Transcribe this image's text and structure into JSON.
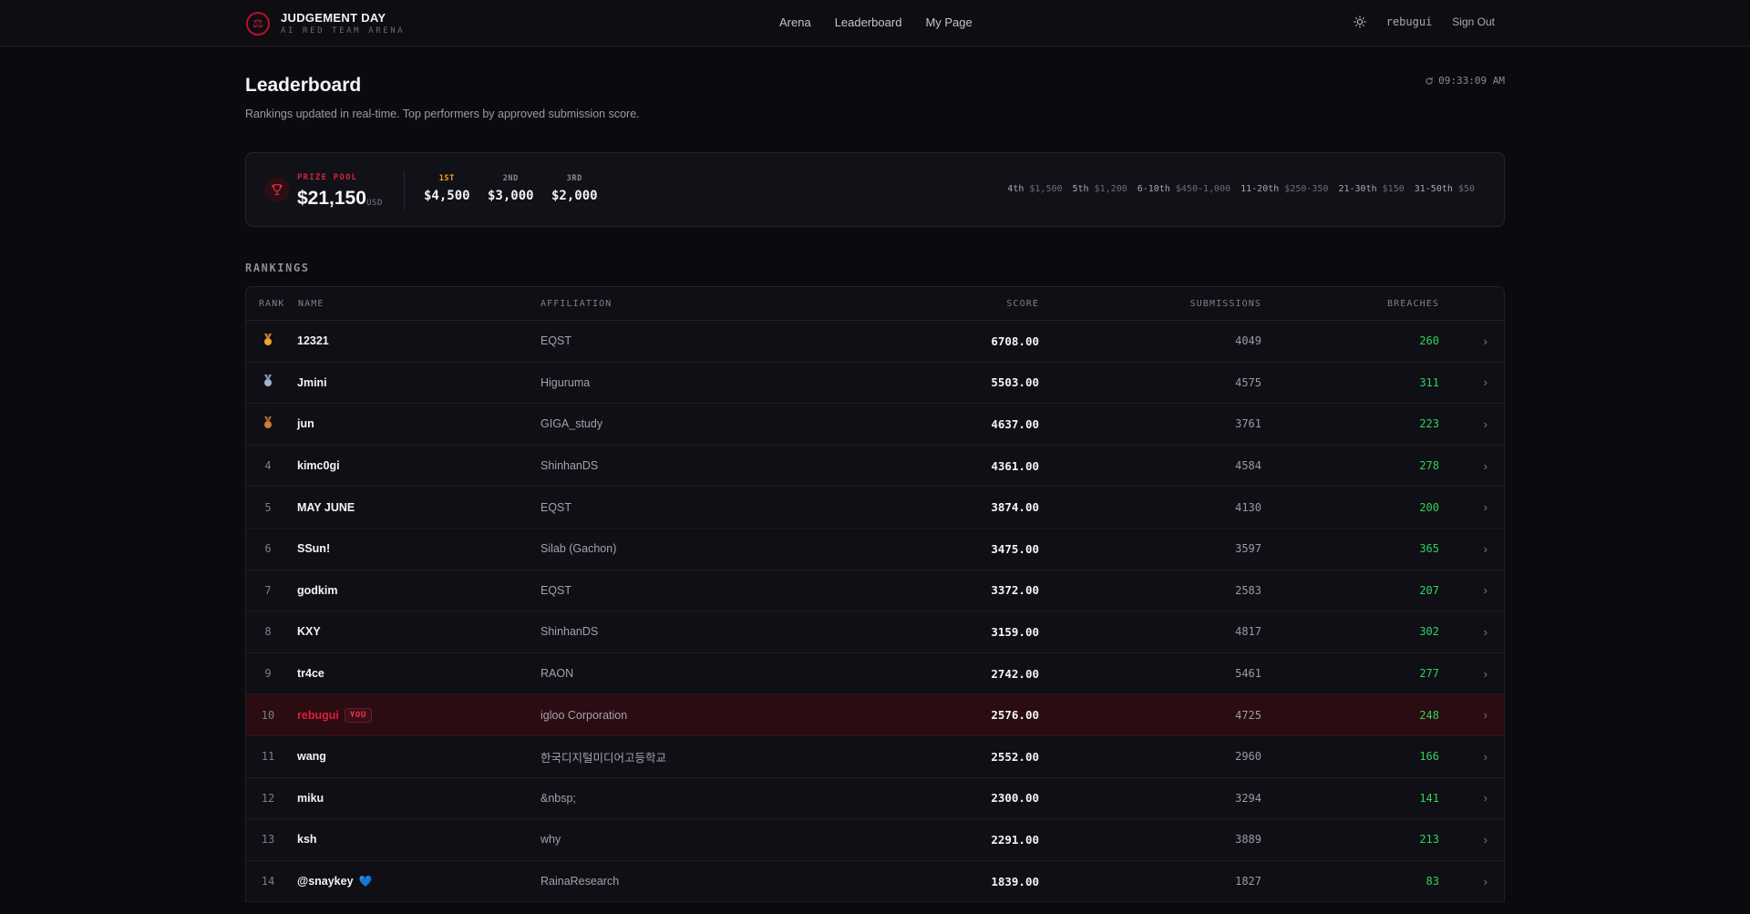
{
  "brand": {
    "title": "JUDGEMENT DAY",
    "subtitle": "AI RED TEAM ARENA",
    "logo_icon": "scales-icon",
    "accent": "#d11a35"
  },
  "nav": {
    "links": [
      "Arena",
      "Leaderboard",
      "My Page"
    ],
    "username": "rebugui",
    "signout": "Sign Out",
    "theme_icon": "sun-icon"
  },
  "page": {
    "title": "Leaderboard",
    "subtitle": "Rankings updated in real-time. Top performers by approved submission score.",
    "updated_time": "09:33:09 AM"
  },
  "prize": {
    "label": "PRIZE POOL",
    "amount": "$21,150",
    "unit": "USD",
    "places": [
      {
        "label": "1ST",
        "amount": "$4,500"
      },
      {
        "label": "2ND",
        "amount": "$3,000"
      },
      {
        "label": "3RD",
        "amount": "$2,000"
      }
    ],
    "tiers": [
      {
        "name": "4th",
        "value": "$1,500"
      },
      {
        "name": "5th",
        "value": "$1,200"
      },
      {
        "name": "6-10th",
        "value": "$450-1,000"
      },
      {
        "name": "11-20th",
        "value": "$250-350"
      },
      {
        "name": "21-30th",
        "value": "$150"
      },
      {
        "name": "31-50th",
        "value": "$50"
      }
    ]
  },
  "rankings": {
    "label": "RANKINGS",
    "columns": [
      "RANK",
      "NAME",
      "AFFILIATION",
      "SCORE",
      "SUBMISSIONS",
      "BREACHES"
    ],
    "you_badge": "YOU",
    "rows": [
      {
        "rank": "1",
        "medal": "gold",
        "name": "12321",
        "affiliation": "EQST",
        "score": "6708.00",
        "submissions": "4049",
        "breaches": "260"
      },
      {
        "rank": "2",
        "medal": "silver",
        "name": "Jmini",
        "affiliation": "Higuruma",
        "score": "5503.00",
        "submissions": "4575",
        "breaches": "311"
      },
      {
        "rank": "3",
        "medal": "bronze",
        "name": "jun",
        "affiliation": "GIGA_study",
        "score": "4637.00",
        "submissions": "3761",
        "breaches": "223"
      },
      {
        "rank": "4",
        "name": "kimc0gi",
        "affiliation": "ShinhanDS",
        "score": "4361.00",
        "submissions": "4584",
        "breaches": "278"
      },
      {
        "rank": "5",
        "name": "MAY JUNE",
        "affiliation": "EQST",
        "score": "3874.00",
        "submissions": "4130",
        "breaches": "200"
      },
      {
        "rank": "6",
        "name": "SSun!",
        "affiliation": "Silab (Gachon)",
        "score": "3475.00",
        "submissions": "3597",
        "breaches": "365"
      },
      {
        "rank": "7",
        "name": "godkim",
        "affiliation": "EQST",
        "score": "3372.00",
        "submissions": "2583",
        "breaches": "207"
      },
      {
        "rank": "8",
        "name": "KXY",
        "affiliation": "ShinhanDS",
        "score": "3159.00",
        "submissions": "4817",
        "breaches": "302"
      },
      {
        "rank": "9",
        "name": "tr4ce",
        "affiliation": "RAON",
        "score": "2742.00",
        "submissions": "5461",
        "breaches": "277"
      },
      {
        "rank": "10",
        "name": "rebugui",
        "you": true,
        "affiliation": "igloo Corporation",
        "score": "2576.00",
        "submissions": "4725",
        "breaches": "248"
      },
      {
        "rank": "11",
        "name": "wang",
        "affiliation": "한국디지털미디어고등학교",
        "score": "2552.00",
        "submissions": "2960",
        "breaches": "166"
      },
      {
        "rank": "12",
        "name": "miku",
        "affiliation": "&nbsp;",
        "score": "2300.00",
        "submissions": "3294",
        "breaches": "141"
      },
      {
        "rank": "13",
        "name": "ksh",
        "affiliation": "why",
        "score": "2291.00",
        "submissions": "3889",
        "breaches": "213"
      },
      {
        "rank": "14",
        "name": "@snaykey",
        "heart": "💙",
        "affiliation": "RainaResearch",
        "score": "1839.00",
        "submissions": "1827",
        "breaches": "83"
      }
    ]
  }
}
